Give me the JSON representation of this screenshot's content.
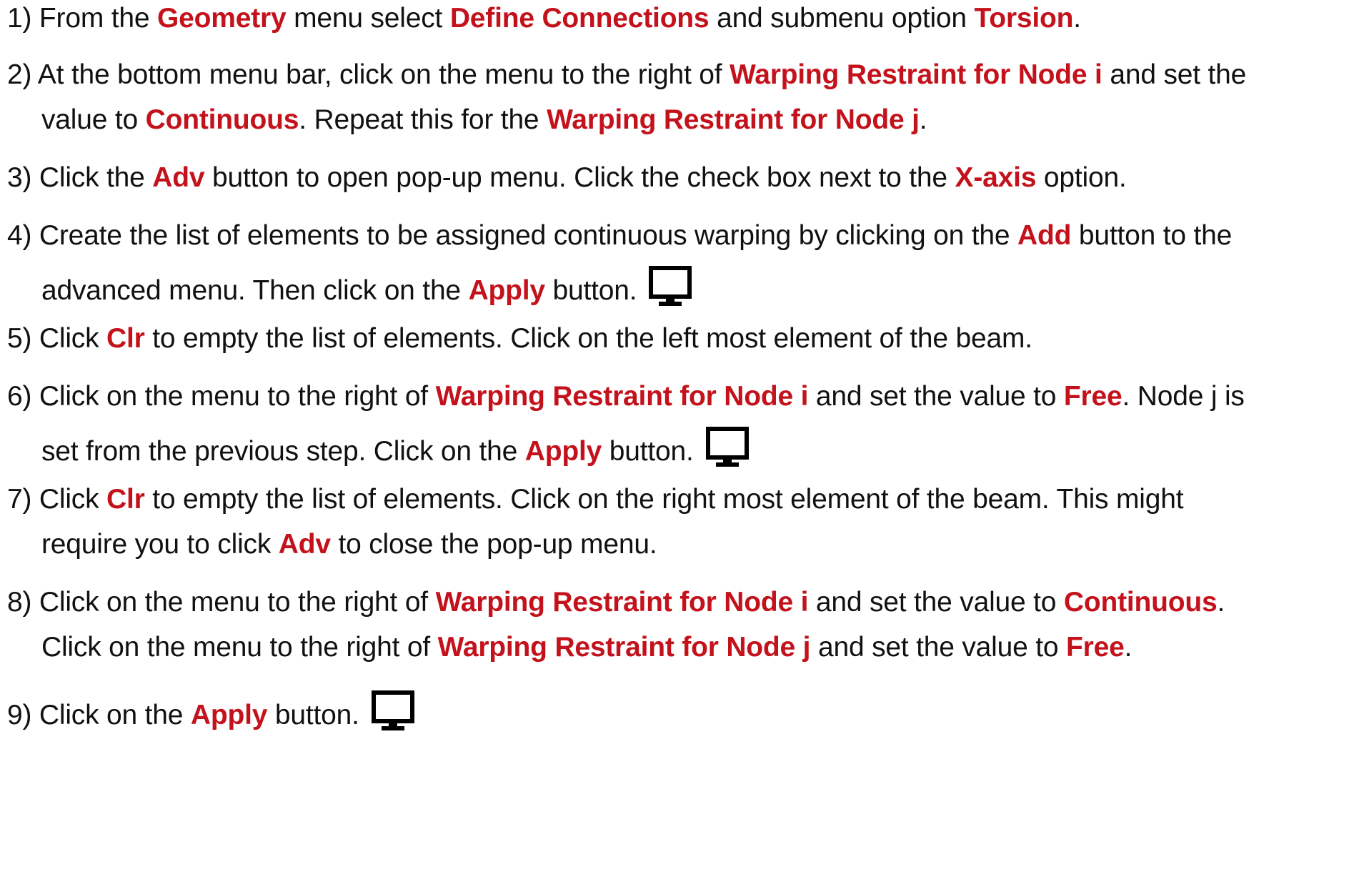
{
  "steps": [
    {
      "lines": [
        [
          {
            "t": "1) From the "
          },
          {
            "t": "Geometry",
            "k": 1
          },
          {
            "t": " menu select "
          },
          {
            "t": "Define Connections",
            "k": 1
          },
          {
            "t": " and submenu option "
          },
          {
            "t": "Torsion",
            "k": 1
          },
          {
            "t": "."
          }
        ]
      ]
    },
    {
      "lines": [
        [
          {
            "t": "2) At the bottom menu bar, click on the menu to the right of "
          },
          {
            "t": "Warping Restraint for Node i",
            "k": 1
          },
          {
            "t": " and set the"
          }
        ],
        [
          {
            "t": "value to "
          },
          {
            "t": "Continuous",
            "k": 1
          },
          {
            "t": ". Repeat this for the "
          },
          {
            "t": "Warping Restraint for Node j",
            "k": 1
          },
          {
            "t": "."
          }
        ]
      ]
    },
    {
      "lines": [
        [
          {
            "t": "3) Click the "
          },
          {
            "t": "Adv",
            "k": 1
          },
          {
            "t": " button to open pop-up menu. Click the check box next to the "
          },
          {
            "t": "X-axis",
            "k": 1
          },
          {
            "t": " option."
          }
        ]
      ]
    },
    {
      "lines": [
        [
          {
            "t": "4) Create the list of elements to be assigned continuous warping by clicking on the "
          },
          {
            "t": "Add",
            "k": 1
          },
          {
            "t": " button to the"
          }
        ],
        [
          {
            "t": "advanced menu. Then click on the "
          },
          {
            "t": "Apply",
            "k": 1
          },
          {
            "t": " button."
          },
          {
            "icon": "monitor-icon"
          }
        ]
      ]
    },
    {
      "lines": [
        [
          {
            "t": "5) Click "
          },
          {
            "t": "Clr",
            "k": 1
          },
          {
            "t": " to empty the list of elements. Click on the left most element of the beam."
          }
        ]
      ]
    },
    {
      "lines": [
        [
          {
            "t": "6) Click on the menu to the right of "
          },
          {
            "t": "Warping Restraint for Node i",
            "k": 1
          },
          {
            "t": " and set the value to "
          },
          {
            "t": "Free",
            "k": 1
          },
          {
            "t": ". Node j is"
          }
        ],
        [
          {
            "t": "set from the previous step. Click on the "
          },
          {
            "t": "Apply",
            "k": 1
          },
          {
            "t": " button."
          },
          {
            "icon": "monitor-icon"
          }
        ]
      ]
    },
    {
      "lines": [
        [
          {
            "t": "7) Click "
          },
          {
            "t": "Clr",
            "k": 1
          },
          {
            "t": " to empty the list of elements. Click on the right most element of the beam. This might"
          }
        ],
        [
          {
            "t": "require you to click "
          },
          {
            "t": "Adv",
            "k": 1
          },
          {
            "t": " to close the pop-up menu."
          }
        ]
      ]
    },
    {
      "lines": [
        [
          {
            "t": "8) Click on the menu to the right of "
          },
          {
            "t": "Warping Restraint for Node i",
            "k": 1
          },
          {
            "t": " and set the value to "
          },
          {
            "t": "Continuous",
            "k": 1
          },
          {
            "t": "."
          }
        ],
        [
          {
            "t": "Click on the menu to the right of "
          },
          {
            "t": "Warping Restraint for Node j",
            "k": 1
          },
          {
            "t": " and set the value to "
          },
          {
            "t": "Free",
            "k": 1
          },
          {
            "t": "."
          }
        ]
      ]
    },
    {
      "lines": [
        [
          {
            "t": "9) Click on the "
          },
          {
            "t": "Apply",
            "k": 1
          },
          {
            "t": " button."
          },
          {
            "icon": "monitor-icon"
          }
        ]
      ]
    }
  ]
}
